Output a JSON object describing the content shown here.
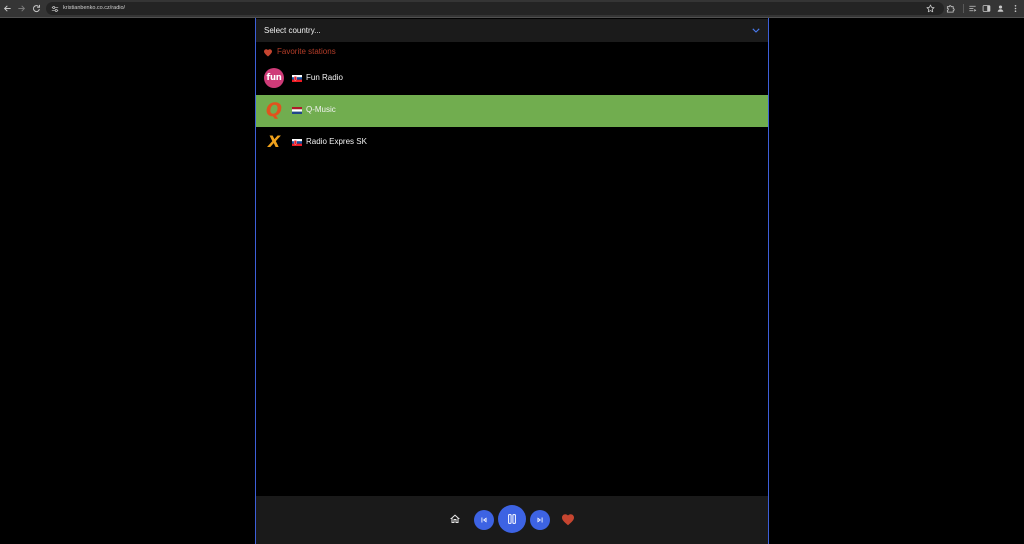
{
  "browser": {
    "url": "kristianbenko.co.cz/radio/",
    "icons": {
      "back": "back-arrow-icon",
      "forward": "forward-arrow-icon",
      "reload": "reload-icon",
      "site_info": "site-settings-icon",
      "bookmark": "bookmark-star-icon",
      "extensions": "extensions-icon",
      "media": "media-controls-icon",
      "side_panel": "side-panel-icon",
      "profile": "profile-icon",
      "menu": "more-menu-icon"
    }
  },
  "country_select": {
    "placeholder": "Select country...",
    "icon": "chevron-down-icon"
  },
  "favorites": {
    "heading": "Favorite stations",
    "icon": "heart-icon"
  },
  "stations": [
    {
      "name": "Fun Radio",
      "logo_icon": "fun-radio-logo",
      "logo_text": "fun",
      "flag_icon": "slovakia-flag-icon",
      "active": false
    },
    {
      "name": "Q-Music",
      "logo_icon": "q-music-logo",
      "logo_text": "Q",
      "flag_icon": "netherlands-flag-icon",
      "active": true
    },
    {
      "name": "Radio Expres SK",
      "logo_icon": "radio-expres-logo",
      "logo_text": "X",
      "flag_icon": "slovakia-flag-icon",
      "active": false
    }
  ],
  "player": {
    "home_icon": "home-icon",
    "previous_icon": "skip-previous-icon",
    "play_pause_icon": "pause-icon",
    "next_icon": "skip-next-icon",
    "favorite_icon": "heart-icon"
  },
  "colors": {
    "page_background": "#000000",
    "toolbar_background": "#353535",
    "omnibox_background": "#242424",
    "panel_border": "#3d5fd8",
    "select_background": "#1b1b1b",
    "chevron": "#4a7bf0",
    "favorite_red": "#c64530",
    "favorite_label": "#b23c28",
    "active_row": "#71ad4f",
    "player_background": "#1a1a1a",
    "player_button": "#3d63e3",
    "fun_logo": "#cf3b78",
    "q_music_logo": "#e0521e",
    "expres_logo": "#f0a21c"
  }
}
